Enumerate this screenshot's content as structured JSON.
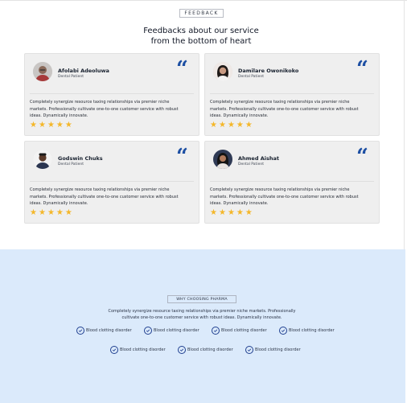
{
  "feedback": {
    "tag": "FEEDBACK",
    "title_line1": "Feedbacks about our service",
    "title_line2": "from the bottom of heart",
    "cards": [
      {
        "name": "Afolabi Adeoluwa",
        "role": "Dental Patient",
        "text": "Completely synergize resource taxing relationships via premier niche markets. Professionally cultivate one-to-one customer service with robust ideas. Dynamically innovate.",
        "rating": 5
      },
      {
        "name": "Damilare Owonikoko",
        "role": "Dental Patient",
        "text": "Completely synergize resource taxing relationships via premier niche markets. Professionally cultivate one-to-one customer service with robust ideas. Dynamically innovate.",
        "rating": 5
      },
      {
        "name": "Godswin Chuks",
        "role": "Dental Patient",
        "text": "Completely synergize resource taxing relationships via premier niche markets. Professionally cultivate one-to-one customer service with robust ideas. Dynamically innovate.",
        "rating": 5
      },
      {
        "name": "Ahmed Aishat",
        "role": "Dental Patient",
        "text": "Completely synergize resource taxing relationships via premier niche markets. Professionally cultivate one-to-one customer service with robust ideas. Dynamically innovate.",
        "rating": 5
      }
    ]
  },
  "why": {
    "tag": "WHY CHOOSING PHARMA",
    "desc_line1": "Completely synergize resource taxing relationships via premier niche markets. Professionally",
    "desc_line2": "cultivate one-to-one customer service with robust ideas. Dynamically innovate.",
    "features": [
      "Blood clotting disorder",
      "Blood clotting disorder",
      "Blood clotting disorder",
      "Blood clotting disorder",
      "Blood clotting disorder",
      "Blood clotting disorder",
      "Blood clotting disorder"
    ]
  },
  "colors": {
    "accent": "#1d4fa3",
    "star": "#f4b72a",
    "card_bg": "#efefef",
    "section_bg": "#dbeafb"
  },
  "icons": {
    "quote": "quote-icon",
    "star": "star-icon",
    "check": "check-circle-icon"
  }
}
